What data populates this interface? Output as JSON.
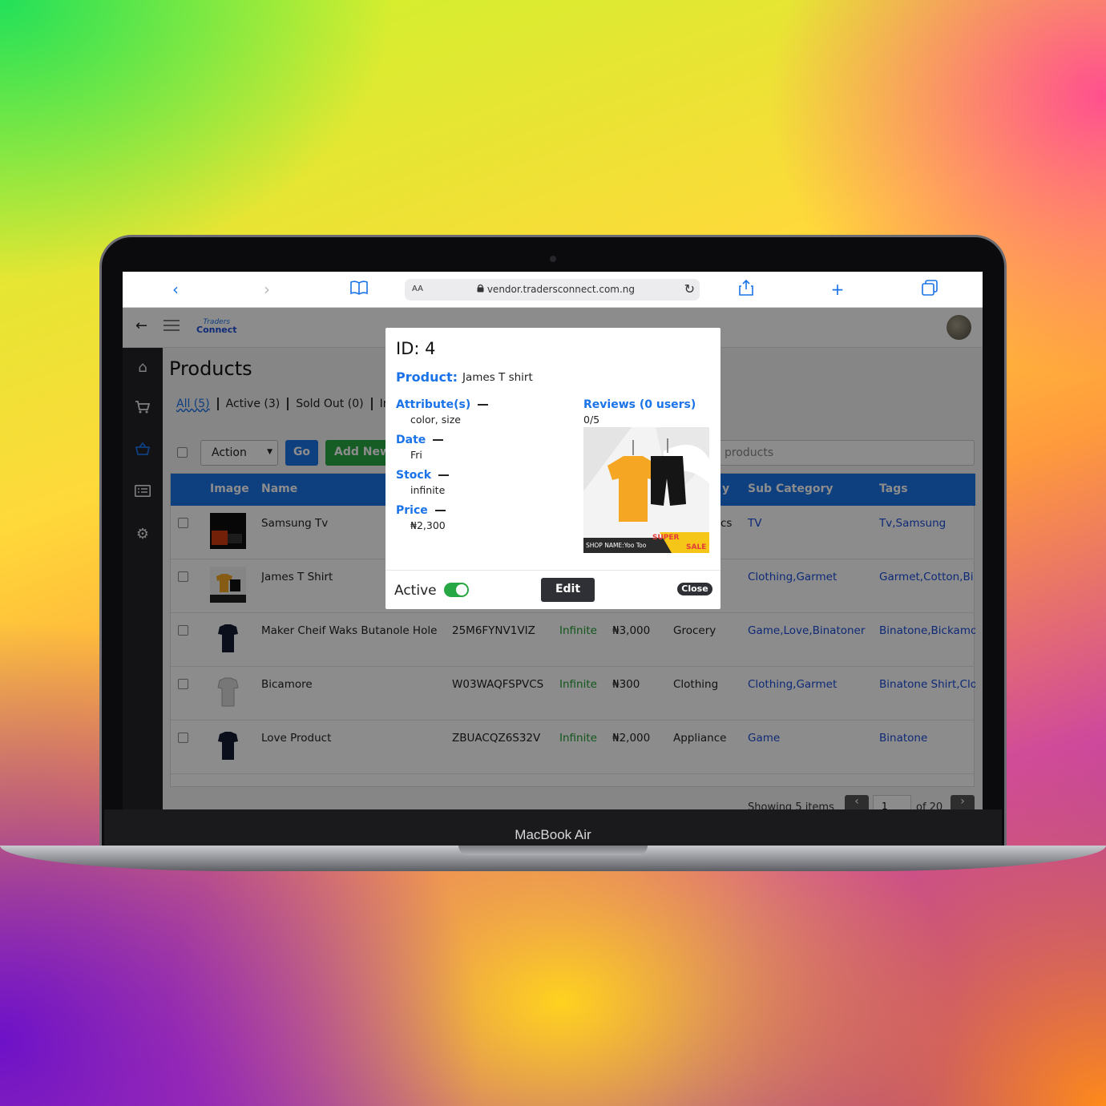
{
  "device": {
    "brand": "MacBook Air"
  },
  "browser": {
    "text_size_label": "AA",
    "url": "vendor.tradersconnect.com.ng",
    "icons": [
      "back-icon",
      "forward-icon",
      "bookmarks-icon",
      "lock-icon",
      "reload-icon",
      "share-icon",
      "new-tab-icon",
      "tabs-icon"
    ]
  },
  "app": {
    "logo": {
      "line1": "Traders",
      "line2": "Connect"
    },
    "sidebar": [
      "home-icon",
      "cart-icon",
      "basket-icon",
      "list-icon",
      "gears-icon"
    ],
    "page_title": "Products",
    "tabs": [
      "All (5)",
      "Active (3)",
      "Sold Out (0)",
      "In"
    ],
    "toolbar": {
      "action_label": "Action",
      "go_label": "Go",
      "add_new_label": "Add New",
      "search_placeholder": "products"
    },
    "table": {
      "headers": {
        "image": "Image",
        "name": "Name",
        "category": "y",
        "sub_category": "Sub Category",
        "tags": "Tags"
      },
      "rows": [
        {
          "name": "Samsung Tv",
          "sku": "",
          "stock": "",
          "price": "",
          "category": "cs",
          "sub_category": "TV",
          "tags": "Tv,Samsung"
        },
        {
          "name": "James T Shirt",
          "sku": "",
          "stock": "",
          "price": "",
          "category": "",
          "sub_category": "Clothing,Garmet",
          "tags": "Garmet,Cotton,Bi"
        },
        {
          "name": "Maker Cheif Waks Butanole Hole",
          "sku": "25M6FYNV1VIZ",
          "stock": "Infinite",
          "price": "₦3,000",
          "category": "Grocery",
          "sub_category": "Game,Love,Binatoner",
          "tags": "Binatone,Bickamo"
        },
        {
          "name": "Bicamore",
          "sku": "W03WAQFSPVCS",
          "stock": "Infinite",
          "price": "₦300",
          "category": "Clothing",
          "sub_category": "Clothing,Garmet",
          "tags": "Binatone Shirt,Clo"
        },
        {
          "name": "Love Product",
          "sku": "ZBUACQZ6S32V",
          "stock": "Infinite",
          "price": "₦2,000",
          "category": "Appliance",
          "sub_category": "Game",
          "tags": "Binatone"
        }
      ]
    },
    "pagination": {
      "showing": "Showing 5 items",
      "page": "1",
      "of": "of 20"
    }
  },
  "modal": {
    "id_text": "ID: 4",
    "product_label": "Product:",
    "product_value": "James T shirt",
    "attributes_label": "Attribute(s)",
    "attributes_value": "color, size",
    "date_label": "Date",
    "date_value": "Fri",
    "stock_label": "Stock",
    "stock_value": "infinite",
    "price_label": "Price",
    "price_value": "₦2,300",
    "reviews_label": "Reviews (0 users)",
    "reviews_value": "0/5",
    "image_caption": "SHOP NAME:Yoo Too",
    "image_badge_1": "SUPER",
    "image_badge_2": "SALE",
    "active_label": "Active",
    "active_on": true,
    "edit_label": "Edit",
    "close_label": "Close"
  },
  "colors": {
    "accent": "#1a73e8",
    "success": "#1f9d32",
    "sidebar": "#232427"
  }
}
